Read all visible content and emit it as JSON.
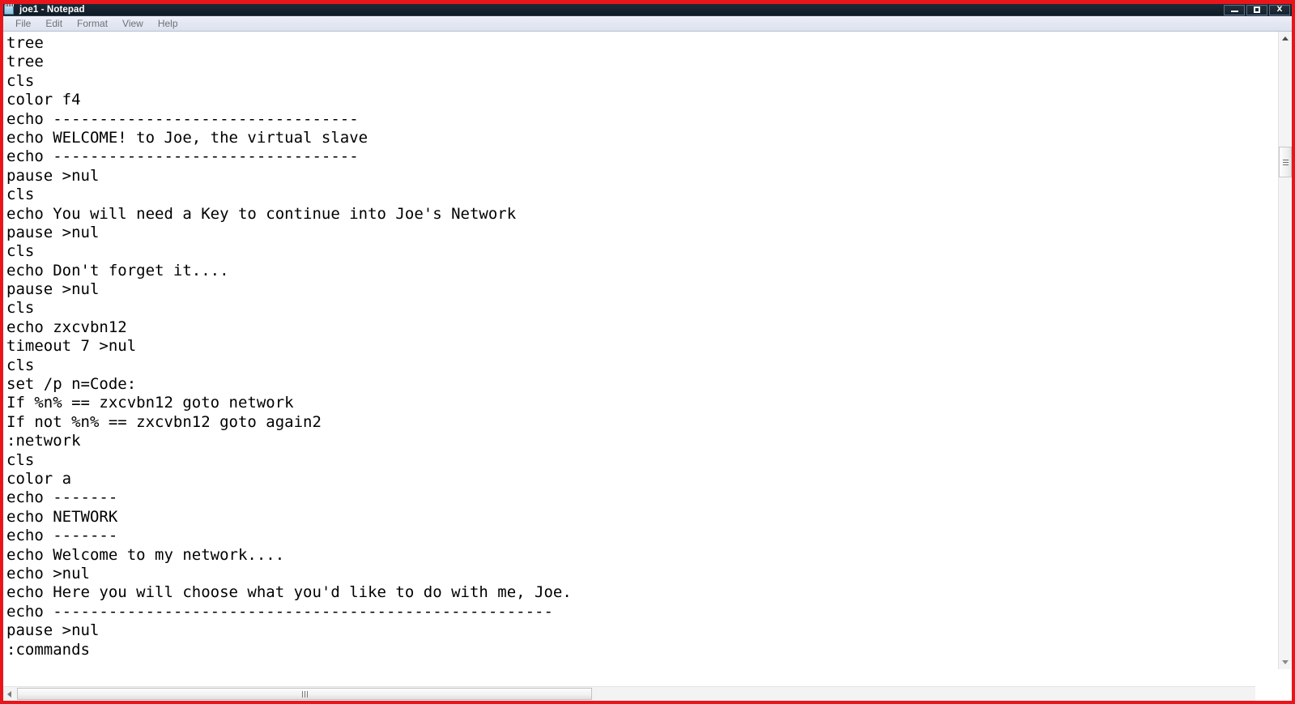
{
  "window": {
    "title": "joe1 - Notepad",
    "icon": "notepad-icon",
    "controls": {
      "minimize_label": "–",
      "maximize_label": "□",
      "close_label": "X"
    },
    "accent_border_color": "#e8161b",
    "titlebar_color": "#16222e"
  },
  "menubar": {
    "items": [
      {
        "label": "File"
      },
      {
        "label": "Edit"
      },
      {
        "label": "Format"
      },
      {
        "label": "View"
      },
      {
        "label": "Help"
      }
    ]
  },
  "editor": {
    "font": "monospace",
    "lines": [
      "tree",
      "tree",
      "cls",
      "color f4",
      "echo ---------------------------------",
      "echo WELCOME! to Joe, the virtual slave",
      "echo ---------------------------------",
      "pause >nul",
      "cls",
      "echo You will need a Key to continue into Joe's Network",
      "pause >nul",
      "cls",
      "echo Don't forget it....",
      "pause >nul",
      "cls",
      "echo zxcvbn12",
      "timeout 7 >nul",
      "cls",
      "set /p n=Code:",
      "If %n% == zxcvbn12 goto network",
      "If not %n% == zxcvbn12 goto again2",
      ":network",
      "cls",
      "color a",
      "echo -------",
      "echo NETWORK",
      "echo -------",
      "echo Welcome to my network....",
      "echo >nul",
      "echo Here you will choose what you'd like to do with me, Joe.",
      "echo ------------------------------------------------------",
      "pause >nul",
      ":commands"
    ]
  },
  "scrollbars": {
    "vertical": {
      "up_arrow": "scroll-up-arrow",
      "down_arrow": "scroll-down-arrow",
      "thumb": "vertical-scroll-thumb"
    },
    "horizontal": {
      "left_arrow": "scroll-left-arrow",
      "thumb": "horizontal-scroll-thumb"
    }
  }
}
